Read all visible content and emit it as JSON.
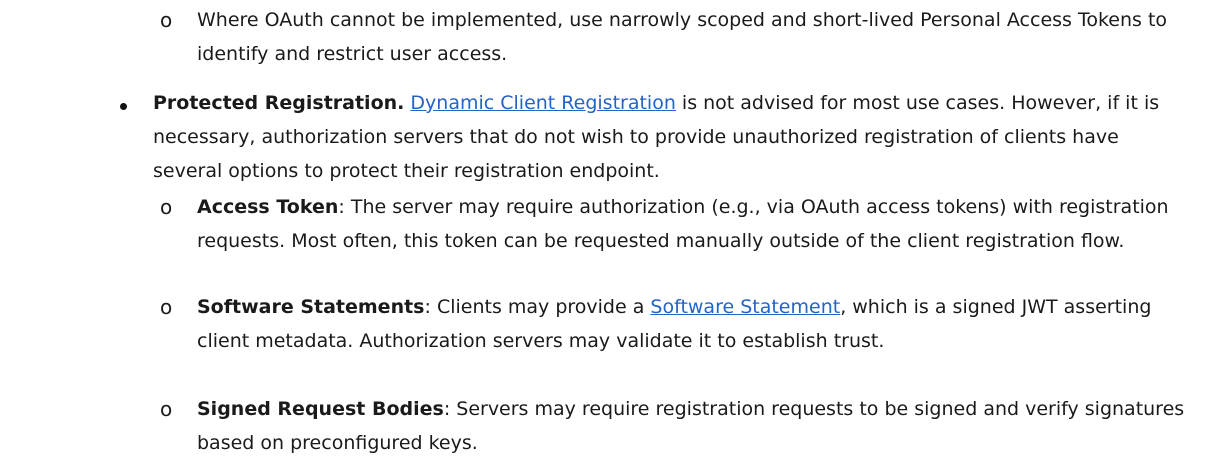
{
  "bullets": [
    {
      "sub": [
        {
          "marker": "o",
          "text": "Where OAuth cannot be implemented, use narrowly scoped and short-lived Personal Access Tokens to identify and restrict user access."
        }
      ]
    },
    {
      "marker": "•",
      "title": "Protected Registration.",
      "link_text": "Dynamic Client Registration",
      "text_after_link": " is not advised for most use cases. However, if it is necessary, authorization servers that do not wish to provide unauthorized registration of clients have several options to protect their registration endpoint.",
      "sub": [
        {
          "marker": "o",
          "title": "Access Token",
          "text": ": The server may require authorization (e.g., via OAuth access tokens) with registration requests. Most often, this token can be requested manually outside of the client registration flow."
        },
        {
          "marker": "o",
          "title": "Software Statements",
          "text_before_link": ": Clients may provide a ",
          "link_text": "Software Statement",
          "text_after_link": ", which is a signed JWT asserting client metadata. Authorization servers may validate it to establish trust."
        },
        {
          "marker": "o",
          "title": "Signed Request Bodies",
          "text": ": Servers may require registration requests to be signed and verify signatures based on preconfigured keys."
        }
      ]
    }
  ]
}
